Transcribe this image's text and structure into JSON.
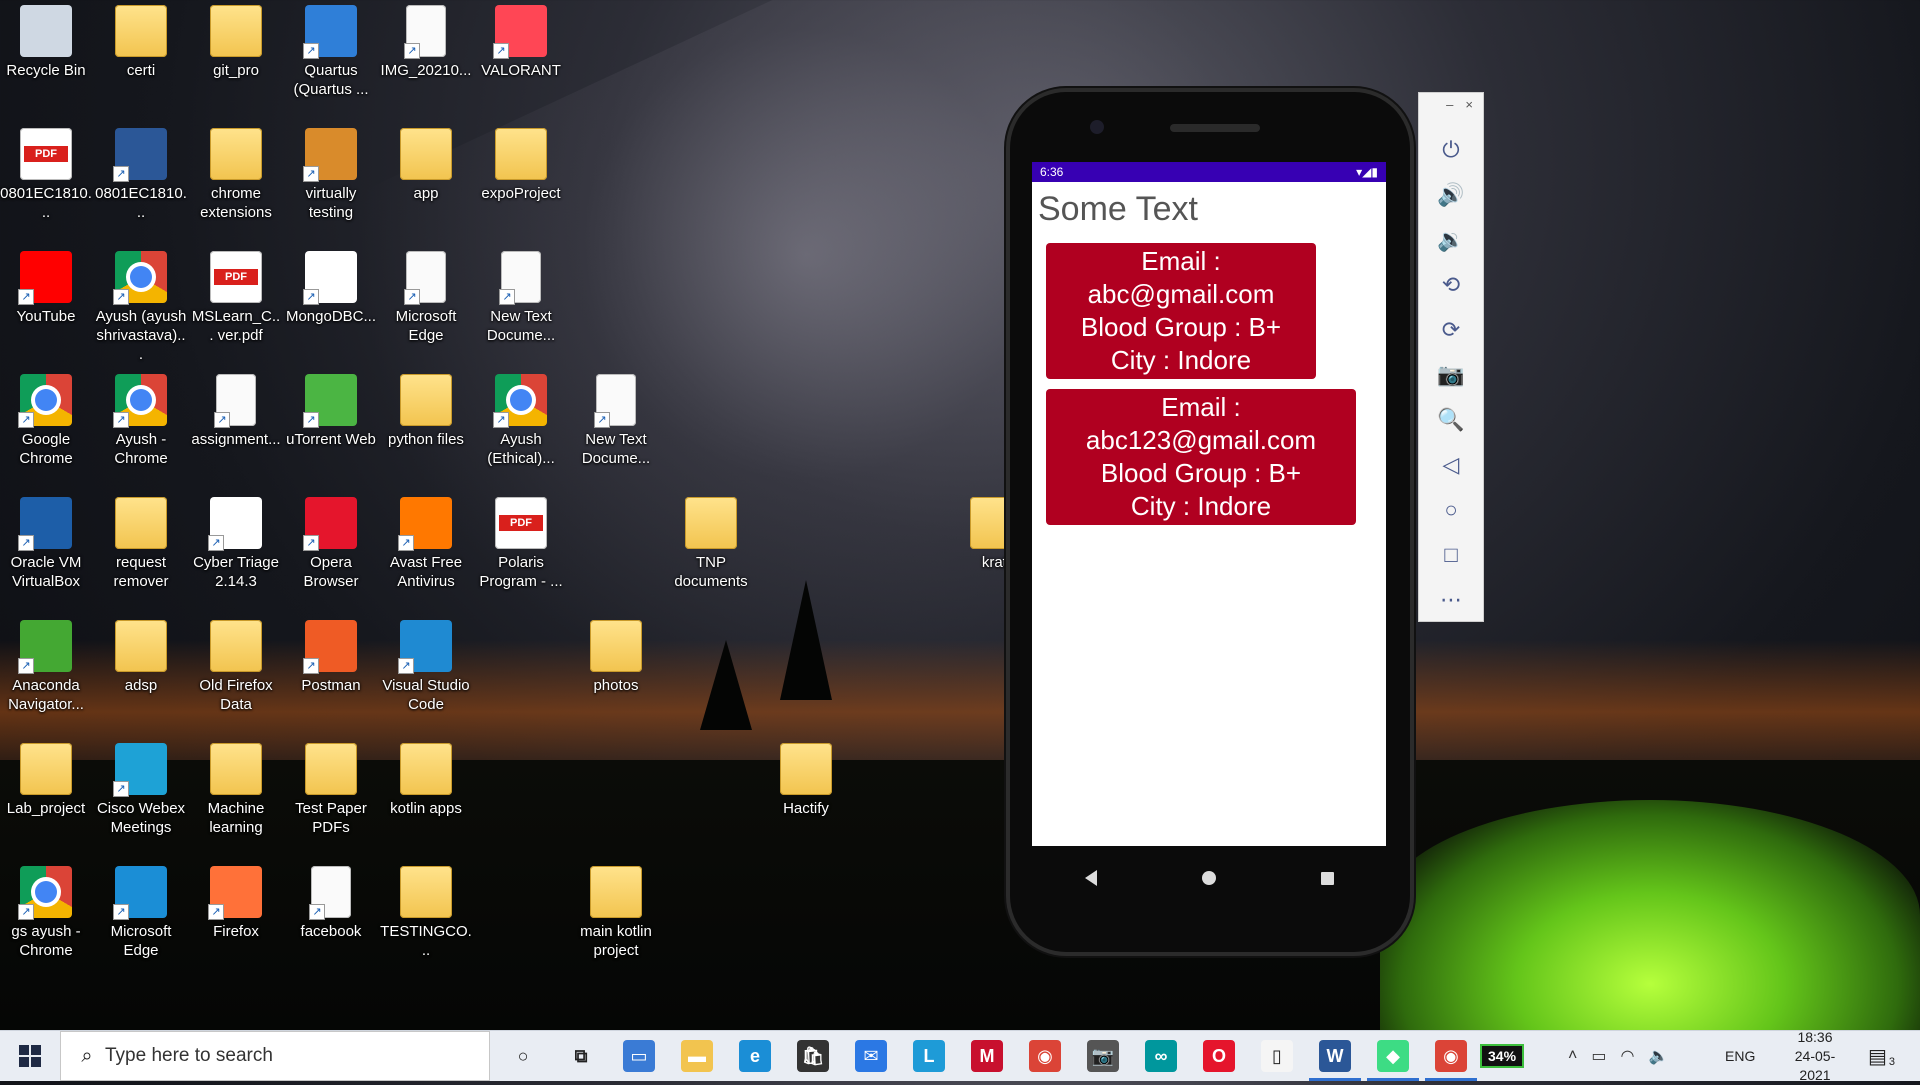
{
  "desktop": {
    "icons": [
      {
        "label": "Recycle Bin",
        "icon": "recycle-bin-icon"
      },
      {
        "label": "certi",
        "icon": "folder-icon"
      },
      {
        "label": "git_pro",
        "icon": "folder-icon"
      },
      {
        "label": "Quartus (Quartus ...",
        "icon": "quartus-icon"
      },
      {
        "label": "IMG_20210...",
        "icon": "image-file-icon"
      },
      {
        "label": "VALORANT",
        "icon": "valorant-icon"
      },
      {
        "label": "0801EC1810...",
        "icon": "pdf-icon"
      },
      {
        "label": "0801EC1810...",
        "icon": "word-icon"
      },
      {
        "label": "chrome extensions",
        "icon": "folder-icon"
      },
      {
        "label": "virtually testing",
        "icon": "archive-icon"
      },
      {
        "label": "app",
        "icon": "folder-icon"
      },
      {
        "label": "expoProject",
        "icon": "folder-icon"
      },
      {
        "label": "YouTube",
        "icon": "youtube-icon"
      },
      {
        "label": "Ayush (ayush shrivastava)...",
        "icon": "chrome-icon"
      },
      {
        "label": "MSLearn_C... ver.pdf",
        "icon": "pdf-icon"
      },
      {
        "label": "MongoDBC...",
        "icon": "mongodb-icon"
      },
      {
        "label": "Microsoft Edge",
        "icon": "file-icon"
      },
      {
        "label": "New Text Docume...",
        "icon": "text-file-icon"
      },
      {
        "label": "Google Chrome",
        "icon": "chrome-icon"
      },
      {
        "label": "Ayush - Chrome",
        "icon": "chrome-icon"
      },
      {
        "label": "assignment...",
        "icon": "text-file-icon"
      },
      {
        "label": "uTorrent Web",
        "icon": "utorrent-icon"
      },
      {
        "label": "python files",
        "icon": "folder-icon"
      },
      {
        "label": "Ayush (Ethical)...",
        "icon": "chrome-icon"
      },
      {
        "label": "New Text Docume...",
        "icon": "text-file-icon"
      },
      {
        "label": "Oracle VM VirtualBox",
        "icon": "virtualbox-icon"
      },
      {
        "label": "request remover",
        "icon": "folder-icon"
      },
      {
        "label": "Cyber Triage 2.14.3",
        "icon": "cyber-triage-icon"
      },
      {
        "label": "Opera Browser",
        "icon": "opera-icon"
      },
      {
        "label": "Avast Free Antivirus",
        "icon": "avast-icon"
      },
      {
        "label": "Polaris Program - ...",
        "icon": "pdf-icon"
      },
      {
        "label": "TNP documents",
        "icon": "folder-icon"
      },
      {
        "label": "krati",
        "icon": "folder-icon"
      },
      {
        "label": "Anaconda Navigator...",
        "icon": "anaconda-icon"
      },
      {
        "label": "adsp",
        "icon": "folder-icon"
      },
      {
        "label": "Old Firefox Data",
        "icon": "folder-icon"
      },
      {
        "label": "Postman",
        "icon": "postman-icon"
      },
      {
        "label": "Visual Studio Code",
        "icon": "vscode-icon"
      },
      {
        "label": "photos",
        "icon": "folder-icon"
      },
      {
        "label": "Lab_project",
        "icon": "folder-icon"
      },
      {
        "label": "Cisco Webex Meetings",
        "icon": "webex-icon"
      },
      {
        "label": "Machine learning",
        "icon": "folder-icon"
      },
      {
        "label": "Test Paper PDFs",
        "icon": "folder-icon"
      },
      {
        "label": "kotlin apps",
        "icon": "folder-icon"
      },
      {
        "label": "Hactify",
        "icon": "folder-icon"
      },
      {
        "label": "gs ayush - Chrome",
        "icon": "chrome-icon"
      },
      {
        "label": "Microsoft Edge",
        "icon": "edge-icon"
      },
      {
        "label": "Firefox",
        "icon": "firefox-icon"
      },
      {
        "label": "facebook",
        "icon": "file-icon"
      },
      {
        "label": "TESTINGCO...",
        "icon": "folder-icon"
      },
      {
        "label": "main kotlin project",
        "icon": "folder-icon"
      }
    ]
  },
  "emulator": {
    "status_time": "6:36",
    "app_title": "Some Text",
    "cards": [
      {
        "email": "Email : abc@gmail.com",
        "blood": "Blood Group : B+",
        "city": "City : Indore"
      },
      {
        "email": "Email : abc123@gmail.com",
        "blood": "Blood Group : B+",
        "city": "City : Indore"
      }
    ],
    "toolbar": {
      "minimize": "–",
      "close": "×",
      "buttons": [
        "power-icon",
        "volume-up-icon",
        "volume-down-icon",
        "rotate-left-icon",
        "rotate-right-icon",
        "camera-icon",
        "zoom-icon",
        "back-icon",
        "home-icon",
        "overview-icon",
        "more-icon"
      ],
      "glyphs": [
        "⏻",
        "🔊",
        "🔉",
        "⟲",
        "⟳",
        "📷",
        "🔍",
        "◁",
        "○",
        "□",
        "⋯"
      ]
    },
    "colors": {
      "status_bar": "#3700b3",
      "card": "#b00020"
    }
  },
  "taskbar": {
    "search_placeholder": "Type here to search",
    "battery": "34%",
    "language": "ENG",
    "time": "18:36",
    "date": "24-05-2021",
    "notifications": "3",
    "apps": [
      "cortana-icon",
      "task-view-icon",
      "this-pc-icon",
      "file-explorer-icon",
      "edge-icon",
      "store-icon",
      "mail-icon",
      "l-app-icon",
      "mcafee-icon",
      "chrome-icon",
      "camera-icon",
      "arduino-icon",
      "opera-icon",
      "notepad-icon",
      "word-icon",
      "android-studio-icon",
      "chrome-profile-icon"
    ]
  }
}
